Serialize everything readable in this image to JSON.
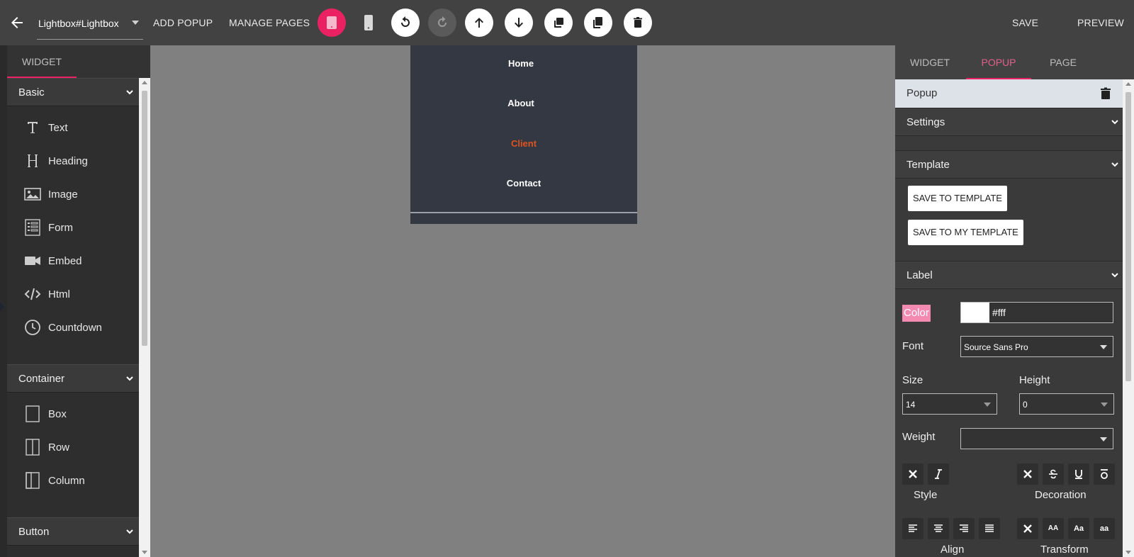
{
  "topbar": {
    "page_select": "Lightbox#Lightbox",
    "add_popup": "ADD POPUP",
    "manage_pages": "MANAGE PAGES",
    "save": "SAVE",
    "preview": "PREVIEW",
    "accent_color": "#ea2264"
  },
  "left": {
    "tab": "WIDGET",
    "sections": [
      {
        "title": "Basic",
        "items": [
          {
            "label": "Text",
            "icon": "text-icon"
          },
          {
            "label": "Heading",
            "icon": "heading-icon"
          },
          {
            "label": "Image",
            "icon": "image-icon"
          },
          {
            "label": "Form",
            "icon": "form-icon"
          },
          {
            "label": "Embed",
            "icon": "video-icon"
          },
          {
            "label": "Html",
            "icon": "code-icon"
          },
          {
            "label": "Countdown",
            "icon": "clock-icon"
          }
        ]
      },
      {
        "title": "Container",
        "items": [
          {
            "label": "Box",
            "icon": "box-icon"
          },
          {
            "label": "Row",
            "icon": "row-icon"
          },
          {
            "label": "Column",
            "icon": "column-icon"
          }
        ]
      },
      {
        "title": "Button",
        "items": []
      }
    ]
  },
  "canvas": {
    "menu": [
      {
        "label": "Home",
        "color": "#ffffff"
      },
      {
        "label": "About",
        "color": "#ffffff"
      },
      {
        "label": "Client",
        "color": "#e0531f"
      },
      {
        "label": "Contact",
        "color": "#ffffff"
      }
    ]
  },
  "right": {
    "tabs": [
      "WIDGET",
      "POPUP",
      "PAGE"
    ],
    "active_tab": "POPUP",
    "popup_title": "Popup",
    "sections": {
      "settings": "Settings",
      "template": "Template",
      "label": "Label"
    },
    "template_buttons": {
      "save_to_template": "SAVE TO TEMPLATE",
      "save_to_my_template": "SAVE TO MY TEMPLATE"
    },
    "label_props": {
      "color_label": "Color",
      "color_value": "#fff",
      "font_label": "Font",
      "font_value": "Source Sans Pro",
      "size_label": "Size",
      "size_value": "14",
      "height_label": "Height",
      "height_value": "0",
      "weight_label": "Weight",
      "weight_value": "",
      "style_label": "Style",
      "decoration_label": "Decoration",
      "align_label": "Align",
      "transform_label": "Transform",
      "transform_upper": "AA",
      "transform_capitalize": "Aa",
      "transform_lower": "aa"
    }
  }
}
